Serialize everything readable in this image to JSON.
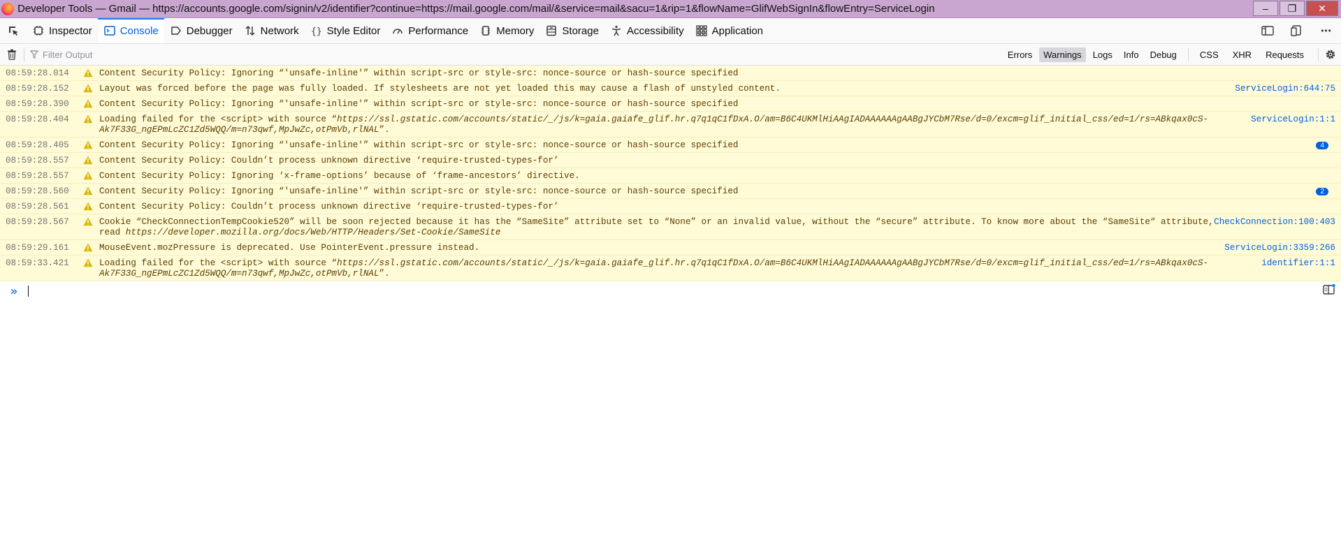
{
  "window": {
    "title": "Developer Tools — Gmail — https://accounts.google.com/signin/v2/identifier?continue=https://mail.google.com/mail/&service=mail&sacu=1&rip=1&flowName=GlifWebSignIn&flowEntry=ServiceLogin",
    "controls": {
      "minimize": "–",
      "maximize": "❐",
      "close": "✕"
    }
  },
  "toolbar": {
    "tabs": [
      {
        "label": "Inspector",
        "icon": "inspector-icon"
      },
      {
        "label": "Console",
        "icon": "console-icon"
      },
      {
        "label": "Debugger",
        "icon": "debugger-icon"
      },
      {
        "label": "Network",
        "icon": "network-icon"
      },
      {
        "label": "Style Editor",
        "icon": "style-editor-icon"
      },
      {
        "label": "Performance",
        "icon": "performance-icon"
      },
      {
        "label": "Memory",
        "icon": "memory-icon"
      },
      {
        "label": "Storage",
        "icon": "storage-icon"
      },
      {
        "label": "Accessibility",
        "icon": "accessibility-icon"
      },
      {
        "label": "Application",
        "icon": "application-icon"
      }
    ],
    "selected": "Console",
    "more_label": "•••"
  },
  "filterbar": {
    "placeholder": "Filter Output",
    "levels": [
      "Errors",
      "Warnings",
      "Logs",
      "Info",
      "Debug"
    ],
    "active_level": "Warnings",
    "categories": [
      "CSS",
      "XHR",
      "Requests"
    ]
  },
  "messages": [
    {
      "time": "08:59:28.014",
      "text": "Content Security Policy: Ignoring “'unsafe-inline'” within script-src or style-src: nonce-source or hash-source specified",
      "location": "",
      "repeat": ""
    },
    {
      "time": "08:59:28.152",
      "text": "Layout was forced before the page was fully loaded. If stylesheets are not yet loaded this may cause a flash of unstyled content.",
      "location": "ServiceLogin:644:75",
      "repeat": ""
    },
    {
      "time": "08:59:28.390",
      "text": "Content Security Policy: Ignoring “'unsafe-inline'” within script-src or style-src: nonce-source or hash-source specified",
      "location": "",
      "repeat": ""
    },
    {
      "time": "08:59:28.404",
      "text_prefix": "Loading failed for the <script> with source “",
      "text_url": "https://ssl.gstatic.com/accounts/static/_/js/k=gaia.gaiafe_glif.hr.q7q1qC1fDxA.O/am=B6C4UKMlHiAAgIADAAAAAAgAABgJYCbM7Rse/d=0/excm=glif_initial_css/ed=1/rs=ABkqax0cS-Ak7F33G_ngEPmLcZC1Zd5WQQ/m=n73qwf,MpJwZc,otPmVb,rlNAL",
      "text_suffix": "”.",
      "location": "ServiceLogin:1:1",
      "repeat": ""
    },
    {
      "time": "08:59:28.405",
      "text": "Content Security Policy: Ignoring “'unsafe-inline'” within script-src or style-src: nonce-source or hash-source specified",
      "location": "",
      "repeat": "4"
    },
    {
      "time": "08:59:28.557",
      "text": "Content Security Policy: Couldn’t process unknown directive ‘require-trusted-types-for’",
      "location": "",
      "repeat": ""
    },
    {
      "time": "08:59:28.557",
      "text": "Content Security Policy: Ignoring ‘x-frame-options’ because of ‘frame-ancestors’ directive.",
      "location": "",
      "repeat": ""
    },
    {
      "time": "08:59:28.560",
      "text": "Content Security Policy: Ignoring “'unsafe-inline'” within script-src or style-src: nonce-source or hash-source specified",
      "location": "",
      "repeat": "2"
    },
    {
      "time": "08:59:28.561",
      "text": "Content Security Policy: Couldn’t process unknown directive ‘require-trusted-types-for’",
      "location": "",
      "repeat": ""
    },
    {
      "time": "08:59:28.567",
      "text_prefix": "Cookie “CheckConnectionTempCookie520” will be soon rejected because it has the “SameSite” attribute set to “None” or an invalid value, without the “secure” attribute. To know more about the “SameSite“ attribute, read ",
      "text_url": "https://developer.mozilla.org/docs/Web/HTTP/Headers/Set-Cookie/SameSite",
      "text_suffix": "",
      "location": "CheckConnection:100:403",
      "repeat": ""
    },
    {
      "time": "08:59:29.161",
      "text": "MouseEvent.mozPressure is deprecated. Use PointerEvent.pressure instead.",
      "location": "ServiceLogin:3359:266",
      "repeat": ""
    },
    {
      "time": "08:59:33.421",
      "text_prefix": "Loading failed for the <script> with source “",
      "text_url": "https://ssl.gstatic.com/accounts/static/_/js/k=gaia.gaiafe_glif.hr.q7q1qC1fDxA.O/am=B6C4UKMlHiAAgIADAAAAAAgAABgJYCbM7Rse/d=0/excm=glif_initial_css/ed=1/rs=ABkqax0cS-Ak7F33G_ngEPmLcZC1Zd5WQQ/m=n73qwf,MpJwZc,otPmVb,rlNAL",
      "text_suffix": "”.",
      "location": "identifier:1:1",
      "repeat": ""
    }
  ],
  "prompt": {
    "chevron": "»"
  },
  "colors": {
    "accent": "#0060df",
    "warning_bg": "#fffbd6",
    "warning_text": "#5c3d00",
    "warning_icon": "#d7b600",
    "titlebar": "#c8a6cf"
  }
}
